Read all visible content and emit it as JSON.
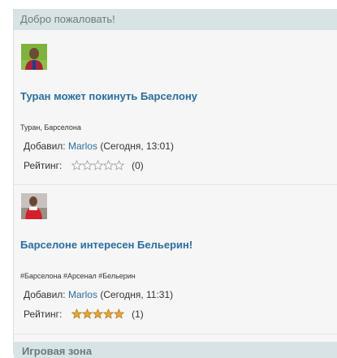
{
  "panel": {
    "header": "Добро пожаловать!"
  },
  "news": [
    {
      "title": "Туран может покинуть Барселону",
      "tags": "Туран, Барселона",
      "added_label": "Добавил:",
      "author": "Marlos",
      "time": "(Сегодня, 13:01)",
      "rating_label": "Рейтинг:",
      "rating_stars": 0,
      "rating_count": "(0)",
      "thumb": "player-photo-green"
    },
    {
      "title": "Барселоне интересен Бельерин!",
      "tags": "#Барселона #Арсенал #Бельерин",
      "added_label": "Добавил:",
      "author": "Marlos",
      "time": "(Сегодня, 11:31)",
      "rating_label": "Рейтинг:",
      "rating_stars": 5,
      "rating_count": "(1)",
      "thumb": "player-photo-red"
    }
  ],
  "bottom_bar": {
    "label": "Игровая зона"
  },
  "colors": {
    "link": "#2b6e9e",
    "header_bg": "#d8e3e6",
    "star_filled": "#e8a83a",
    "star_empty": "#cfcfcf"
  }
}
